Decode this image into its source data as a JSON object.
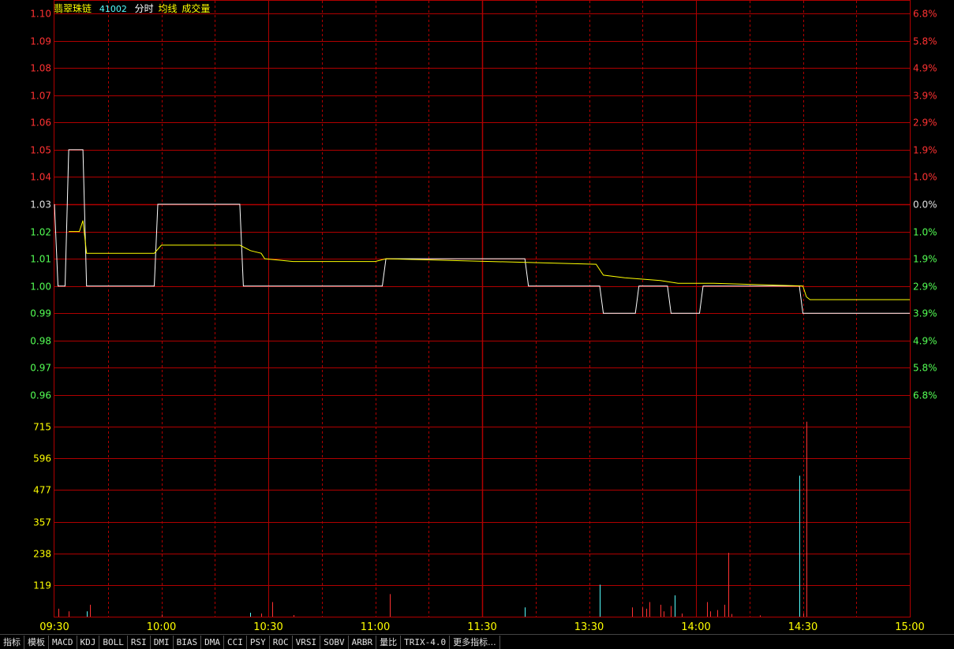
{
  "header": {
    "stock_name": "翡翠珠链",
    "stock_code": "41002",
    "view_label": "分时",
    "avg_label": "均线",
    "volume_label": "成交量"
  },
  "colors": {
    "up": "#ff3232",
    "down": "#54ff54",
    "flat": "#e0e0e0",
    "price_line": "#ffffff",
    "avg_line": "#ffff00",
    "volume_axis": "#ffff00",
    "grid": "#b00000",
    "volume_up": "#ff3232",
    "volume_down": "#54ffff"
  },
  "chart_data": {
    "type": "line",
    "prev_close": 1.03,
    "price_axis": {
      "ticks": [
        "1.10",
        "1.09",
        "1.08",
        "1.07",
        "1.06",
        "1.05",
        "1.04",
        "1.03",
        "1.02",
        "1.01",
        "1.00",
        "0.99",
        "0.98",
        "0.97",
        "0.96"
      ],
      "values": [
        1.1,
        1.09,
        1.08,
        1.07,
        1.06,
        1.05,
        1.04,
        1.03,
        1.02,
        1.01,
        1.0,
        0.99,
        0.98,
        0.97,
        0.96
      ]
    },
    "percent_axis": {
      "ticks": [
        "6.8%",
        "5.8%",
        "4.9%",
        "3.9%",
        "2.9%",
        "1.9%",
        "1.0%",
        "0.0%",
        "1.0%",
        "1.9%",
        "2.9%",
        "3.9%",
        "4.9%",
        "5.8%",
        "6.8%"
      ]
    },
    "volume_axis": {
      "ticks": [
        "715",
        "596",
        "477",
        "357",
        "238",
        "119"
      ],
      "values": [
        715,
        596,
        477,
        357,
        238,
        119
      ],
      "ylim": [
        0,
        833
      ]
    },
    "time_axis": {
      "ticks": [
        "09:30",
        "10:00",
        "10:30",
        "11:00",
        "11:30",
        "13:30",
        "14:00",
        "14:30",
        "15:00"
      ],
      "minutes": [
        0,
        30,
        60,
        90,
        120,
        150,
        180,
        210,
        240
      ]
    },
    "series": [
      {
        "name": "price",
        "points": [
          [
            0,
            1.03
          ],
          [
            1,
            1.0
          ],
          [
            3,
            1.0
          ],
          [
            4,
            1.05
          ],
          [
            8,
            1.05
          ],
          [
            9,
            1.0
          ],
          [
            28,
            1.0
          ],
          [
            29,
            1.03
          ],
          [
            52,
            1.03
          ],
          [
            53,
            1.0
          ],
          [
            92,
            1.0
          ],
          [
            93,
            1.01
          ],
          [
            132,
            1.01
          ],
          [
            133,
            1.0
          ],
          [
            153,
            1.0
          ],
          [
            154,
            0.99
          ],
          [
            163,
            0.99
          ],
          [
            164,
            1.0
          ],
          [
            172,
            1.0
          ],
          [
            173,
            0.99
          ],
          [
            181,
            0.99
          ],
          [
            182,
            1.0
          ],
          [
            209,
            1.0
          ],
          [
            210,
            0.99
          ],
          [
            240,
            0.99
          ]
        ]
      },
      {
        "name": "average",
        "points": [
          [
            4,
            1.02
          ],
          [
            7,
            1.02
          ],
          [
            8,
            1.024
          ],
          [
            9,
            1.012
          ],
          [
            28,
            1.012
          ],
          [
            30,
            1.015
          ],
          [
            52,
            1.015
          ],
          [
            55,
            1.013
          ],
          [
            58,
            1.012
          ],
          [
            59,
            1.01
          ],
          [
            67,
            1.009
          ],
          [
            90,
            1.009
          ],
          [
            93,
            1.01
          ],
          [
            152,
            1.008
          ],
          [
            154,
            1.004
          ],
          [
            160,
            1.003
          ],
          [
            170,
            1.002
          ],
          [
            175,
            1.001
          ],
          [
            185,
            1.001
          ],
          [
            210,
            1.0
          ],
          [
            211,
            0.996
          ],
          [
            212,
            0.995
          ],
          [
            240,
            0.995
          ]
        ]
      }
    ],
    "volume": [
      {
        "t": 1,
        "v": 30,
        "dir": "up"
      },
      {
        "t": 4,
        "v": 20,
        "dir": "up"
      },
      {
        "t": 9,
        "v": 20,
        "dir": "down"
      },
      {
        "t": 10,
        "v": 45,
        "dir": "up"
      },
      {
        "t": 30,
        "v": 8,
        "dir": "up"
      },
      {
        "t": 55,
        "v": 15,
        "dir": "down"
      },
      {
        "t": 58,
        "v": 12,
        "dir": "up"
      },
      {
        "t": 61,
        "v": 55,
        "dir": "up"
      },
      {
        "t": 67,
        "v": 6,
        "dir": "up"
      },
      {
        "t": 94,
        "v": 85,
        "dir": "up"
      },
      {
        "t": 132,
        "v": 35,
        "dir": "down"
      },
      {
        "t": 153,
        "v": 120,
        "dir": "down"
      },
      {
        "t": 162,
        "v": 35,
        "dir": "up"
      },
      {
        "t": 165,
        "v": 35,
        "dir": "up"
      },
      {
        "t": 166,
        "v": 30,
        "dir": "up"
      },
      {
        "t": 167,
        "v": 55,
        "dir": "up"
      },
      {
        "t": 170,
        "v": 45,
        "dir": "up"
      },
      {
        "t": 171,
        "v": 20,
        "dir": "up"
      },
      {
        "t": 173,
        "v": 40,
        "dir": "up"
      },
      {
        "t": 174,
        "v": 80,
        "dir": "down"
      },
      {
        "t": 176,
        "v": 12,
        "dir": "up"
      },
      {
        "t": 183,
        "v": 55,
        "dir": "up"
      },
      {
        "t": 184,
        "v": 20,
        "dir": "up"
      },
      {
        "t": 186,
        "v": 25,
        "dir": "up"
      },
      {
        "t": 188,
        "v": 45,
        "dir": "up"
      },
      {
        "t": 189,
        "v": 240,
        "dir": "up"
      },
      {
        "t": 190,
        "v": 10,
        "dir": "up"
      },
      {
        "t": 198,
        "v": 5,
        "dir": "up"
      },
      {
        "t": 209,
        "v": 530,
        "dir": "down"
      },
      {
        "t": 210,
        "v": 12,
        "dir": "up"
      },
      {
        "t": 211,
        "v": 733,
        "dir": "up"
      }
    ]
  },
  "tabs": [
    "指标",
    "模板",
    "MACD",
    "KDJ",
    "BOLL",
    "RSI",
    "DMI",
    "BIAS",
    "DMA",
    "CCI",
    "PSY",
    "ROC",
    "VRSI",
    "SOBV",
    "ARBR",
    "量比",
    "TRIX-4.0",
    "更多指标..."
  ]
}
